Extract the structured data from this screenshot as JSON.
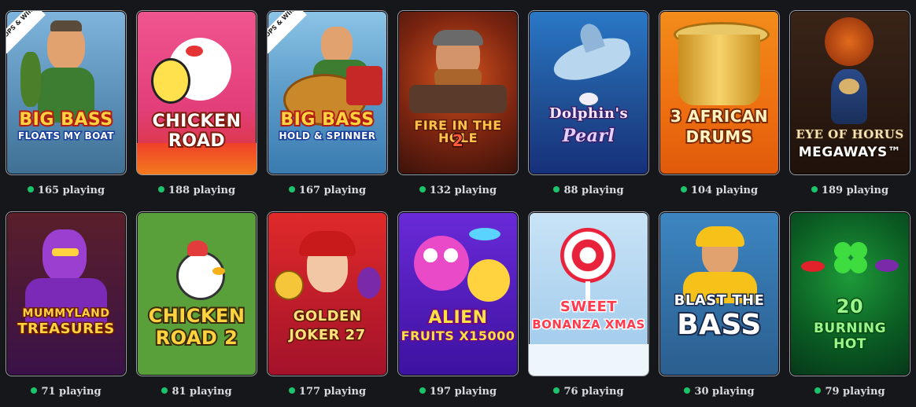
{
  "games": [
    {
      "title_line1": "Big Bass",
      "title_line2": "Floats My Boat",
      "badge": "DROPS & WINS",
      "players": "165 playing",
      "bg": "#6fa3c9",
      "accent": "#e63b1d",
      "text_color": "#ffd23f"
    },
    {
      "title_line1": "Chicken",
      "title_line2": "Road",
      "badge": "",
      "players": "188 playing",
      "bg": "#ea3f86",
      "accent": "#f6b01a",
      "text_color": "#ffffff"
    },
    {
      "title_line1": "Big Bass",
      "title_line2": "Hold & Spinner",
      "badge": "DROPS & WINS",
      "players": "167 playing",
      "bg": "#78b4d9",
      "accent": "#d22c1d",
      "text_color": "#ffd23f"
    },
    {
      "title_line1": "Fire in the Hole",
      "title_line2": "2",
      "badge": "",
      "players": "132 playing",
      "bg": "#6a2412",
      "accent": "#f06b1f",
      "text_color": "#ffc14a"
    },
    {
      "title_line1": "Dolphin's",
      "title_line2": "Pearl",
      "badge": "",
      "players": "88 playing",
      "bg": "#2463a8",
      "accent": "#a9d4f2",
      "text_color": "#f2e7ff"
    },
    {
      "title_line1": "3 African",
      "title_line2": "Drums",
      "badge": "",
      "players": "104 playing",
      "bg": "#f07a12",
      "accent": "#f9c23b",
      "text_color": "#ffe9a8"
    },
    {
      "title_line1": "Eye of Horus",
      "title_line2": "Megaways™",
      "badge": "",
      "players": "189 playing",
      "bg": "#2b1a12",
      "accent": "#c8912f",
      "text_color": "#f4e3b5"
    },
    {
      "title_line1": "Mummyland",
      "title_line2": "Treasures",
      "badge": "",
      "players": "71 playing",
      "bg": "#4b1a6e",
      "accent": "#b75ae6",
      "text_color": "#ffd23f"
    },
    {
      "title_line1": "Chicken",
      "title_line2": "Road 2",
      "badge": "",
      "players": "81 playing",
      "bg": "#5aa03a",
      "accent": "#e23c3c",
      "text_color": "#ffd23f"
    },
    {
      "title_line1": "Golden",
      "title_line2": "Joker 27",
      "badge": "",
      "players": "177 playing",
      "bg": "#c4182a",
      "accent": "#f5c63a",
      "text_color": "#ffe07a"
    },
    {
      "title_line1": "Alien",
      "title_line2": "Fruits x15000",
      "badge": "",
      "players": "197 playing",
      "bg": "#5a1cc4",
      "accent": "#f04ad6",
      "text_color": "#ffe23f"
    },
    {
      "title_line1": "Sweet",
      "title_line2": "Bonanza Xmas",
      "badge": "",
      "players": "76 playing",
      "bg": "#b6d8f1",
      "accent": "#e7223a",
      "text_color": "#ff3b4e"
    },
    {
      "title_line1": "Blast the",
      "title_line2": "Bass",
      "badge": "",
      "players": "30 playing",
      "bg": "#2e6fa3",
      "accent": "#f6c21a",
      "text_color": "#ffffff"
    },
    {
      "title_line1": "20",
      "title_line2": "Burning Hot",
      "badge": "",
      "players": "79 playing",
      "bg": "#0e6a2a",
      "accent": "#3fdc3f",
      "text_color": "#9af58a"
    }
  ]
}
